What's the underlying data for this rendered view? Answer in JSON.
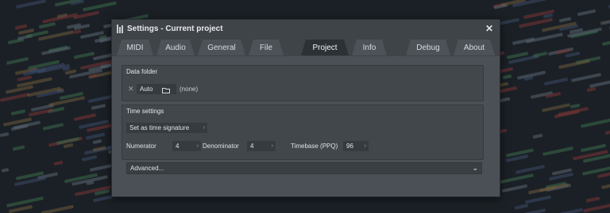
{
  "window": {
    "title": "Settings - Current project",
    "close_glyph": "✕"
  },
  "tabs": [
    {
      "label": "MIDI",
      "active": false
    },
    {
      "label": "Audio",
      "active": false
    },
    {
      "label": "General",
      "active": false
    },
    {
      "label": "File",
      "active": false
    },
    {
      "label": "Project",
      "active": true
    },
    {
      "label": "Info",
      "active": false
    },
    {
      "label": "Debug",
      "active": false
    },
    {
      "label": "About",
      "active": false
    }
  ],
  "data_folder": {
    "label": "Data folder",
    "clear_glyph": "✕",
    "mode": "Auto",
    "folder_icon": "folder-icon",
    "path": "(none)"
  },
  "time_settings": {
    "label": "Time settings",
    "mode_value": "Set as time signature",
    "numerator_label": "Numerator",
    "numerator_value": "4",
    "denominator_label": "Denominator",
    "denominator_value": "4",
    "timebase_label": "Timebase (PPQ)",
    "timebase_value": "96"
  },
  "advanced": {
    "label": "Advanced...",
    "chevron": "⌄"
  },
  "colors": {
    "background": "#1b2026",
    "dialog": "#4a5055",
    "active_tab": "#2c3136"
  }
}
